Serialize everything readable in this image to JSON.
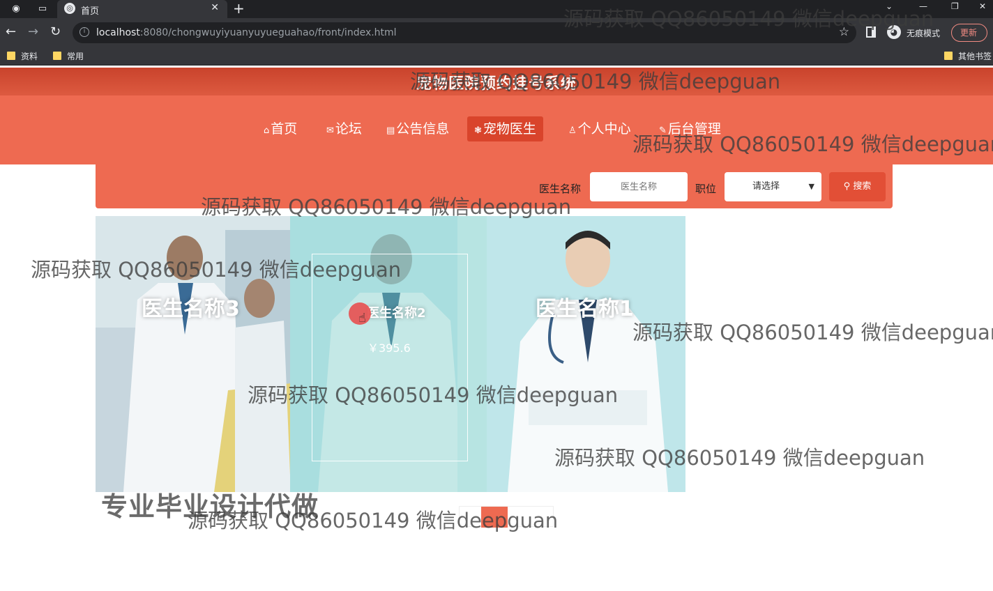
{
  "browser": {
    "tab_title": "首页",
    "url_host": "localhost",
    "url_rest": ":8080/chongwuyiyuanyuyueguahao/front/index.html",
    "incognito_label": "无痕模式",
    "update_label": "更新",
    "bookmarks": [
      "资料",
      "常用"
    ],
    "other_bookmarks": "其他书签"
  },
  "site": {
    "title": "宠物医院预约挂号系统",
    "menu": [
      {
        "icon": "⌂",
        "label": "首页"
      },
      {
        "icon": "✉",
        "label": "论坛"
      },
      {
        "icon": "▤",
        "label": "公告信息"
      },
      {
        "icon": "❃",
        "label": "宠物医生"
      },
      {
        "icon": "♙",
        "label": "个人中心"
      },
      {
        "icon": "✎",
        "label": "后台管理"
      }
    ],
    "active_menu": "宠物医生"
  },
  "search": {
    "name_label": "医生名称",
    "name_placeholder": "医生名称",
    "position_label": "职位",
    "position_value": "请选择",
    "button_label": "搜索"
  },
  "doctors": [
    {
      "name": "医生名称3"
    },
    {
      "name": "医生名称2",
      "price": "￥395.6"
    },
    {
      "name": "医生名称1"
    }
  ],
  "promo_text": "专业毕业设计代做",
  "watermark_text": "源码获取 QQ86050149 微信deepguan"
}
